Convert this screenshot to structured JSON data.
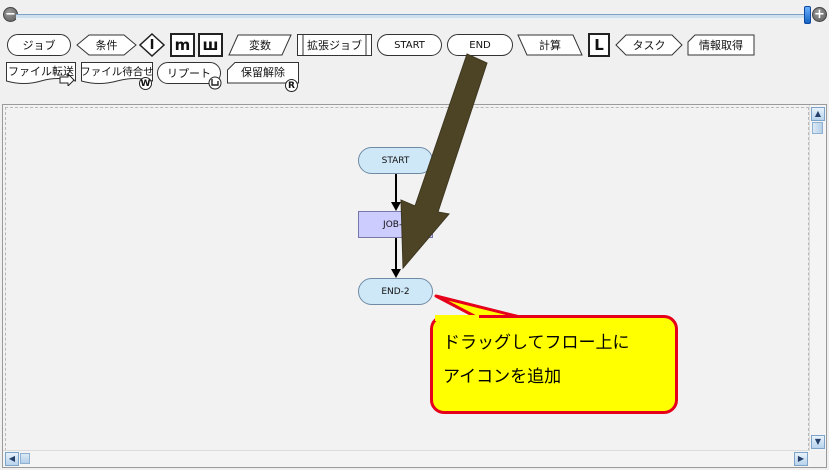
{
  "zoom": {
    "out_icon": "minus-circle-icon",
    "in_icon": "plus-circle-icon",
    "out_glyph": "−",
    "in_glyph": "+"
  },
  "palette": {
    "row1": {
      "job": "ジョブ",
      "condition": "条件",
      "icon_i": "I",
      "icon_m": "m",
      "icon_w": "ш",
      "variable": "変数",
      "ext_job": "拡張ジョブ",
      "start": "START",
      "end": "END",
      "calc": "計算",
      "icon_l": "L",
      "task": "タスク",
      "info_get": "情報取得"
    },
    "row2": {
      "file_transfer": "ファイル転送",
      "file_wait": "ファイル待合せ",
      "file_wait_badge": "W",
      "repeat": "リプート",
      "hold_release": "保留解除",
      "hold_release_badge": "R"
    }
  },
  "flow": {
    "nodes": {
      "start": "START",
      "job": "JOB-1",
      "end": "END-2"
    }
  },
  "callout": {
    "line1": "ドラッグしてフロー上に",
    "line2": "アイコンを追加"
  },
  "scrollbar_glyphs": {
    "up": "▲",
    "down": "▼",
    "left": "◀",
    "right": "▶"
  },
  "colors": {
    "callout_fill": "#ffff00",
    "callout_border": "#e6001a",
    "arrow_fill": "#4d4426",
    "node_terminal": "#cfe8f8",
    "node_job": "#ccccff"
  }
}
